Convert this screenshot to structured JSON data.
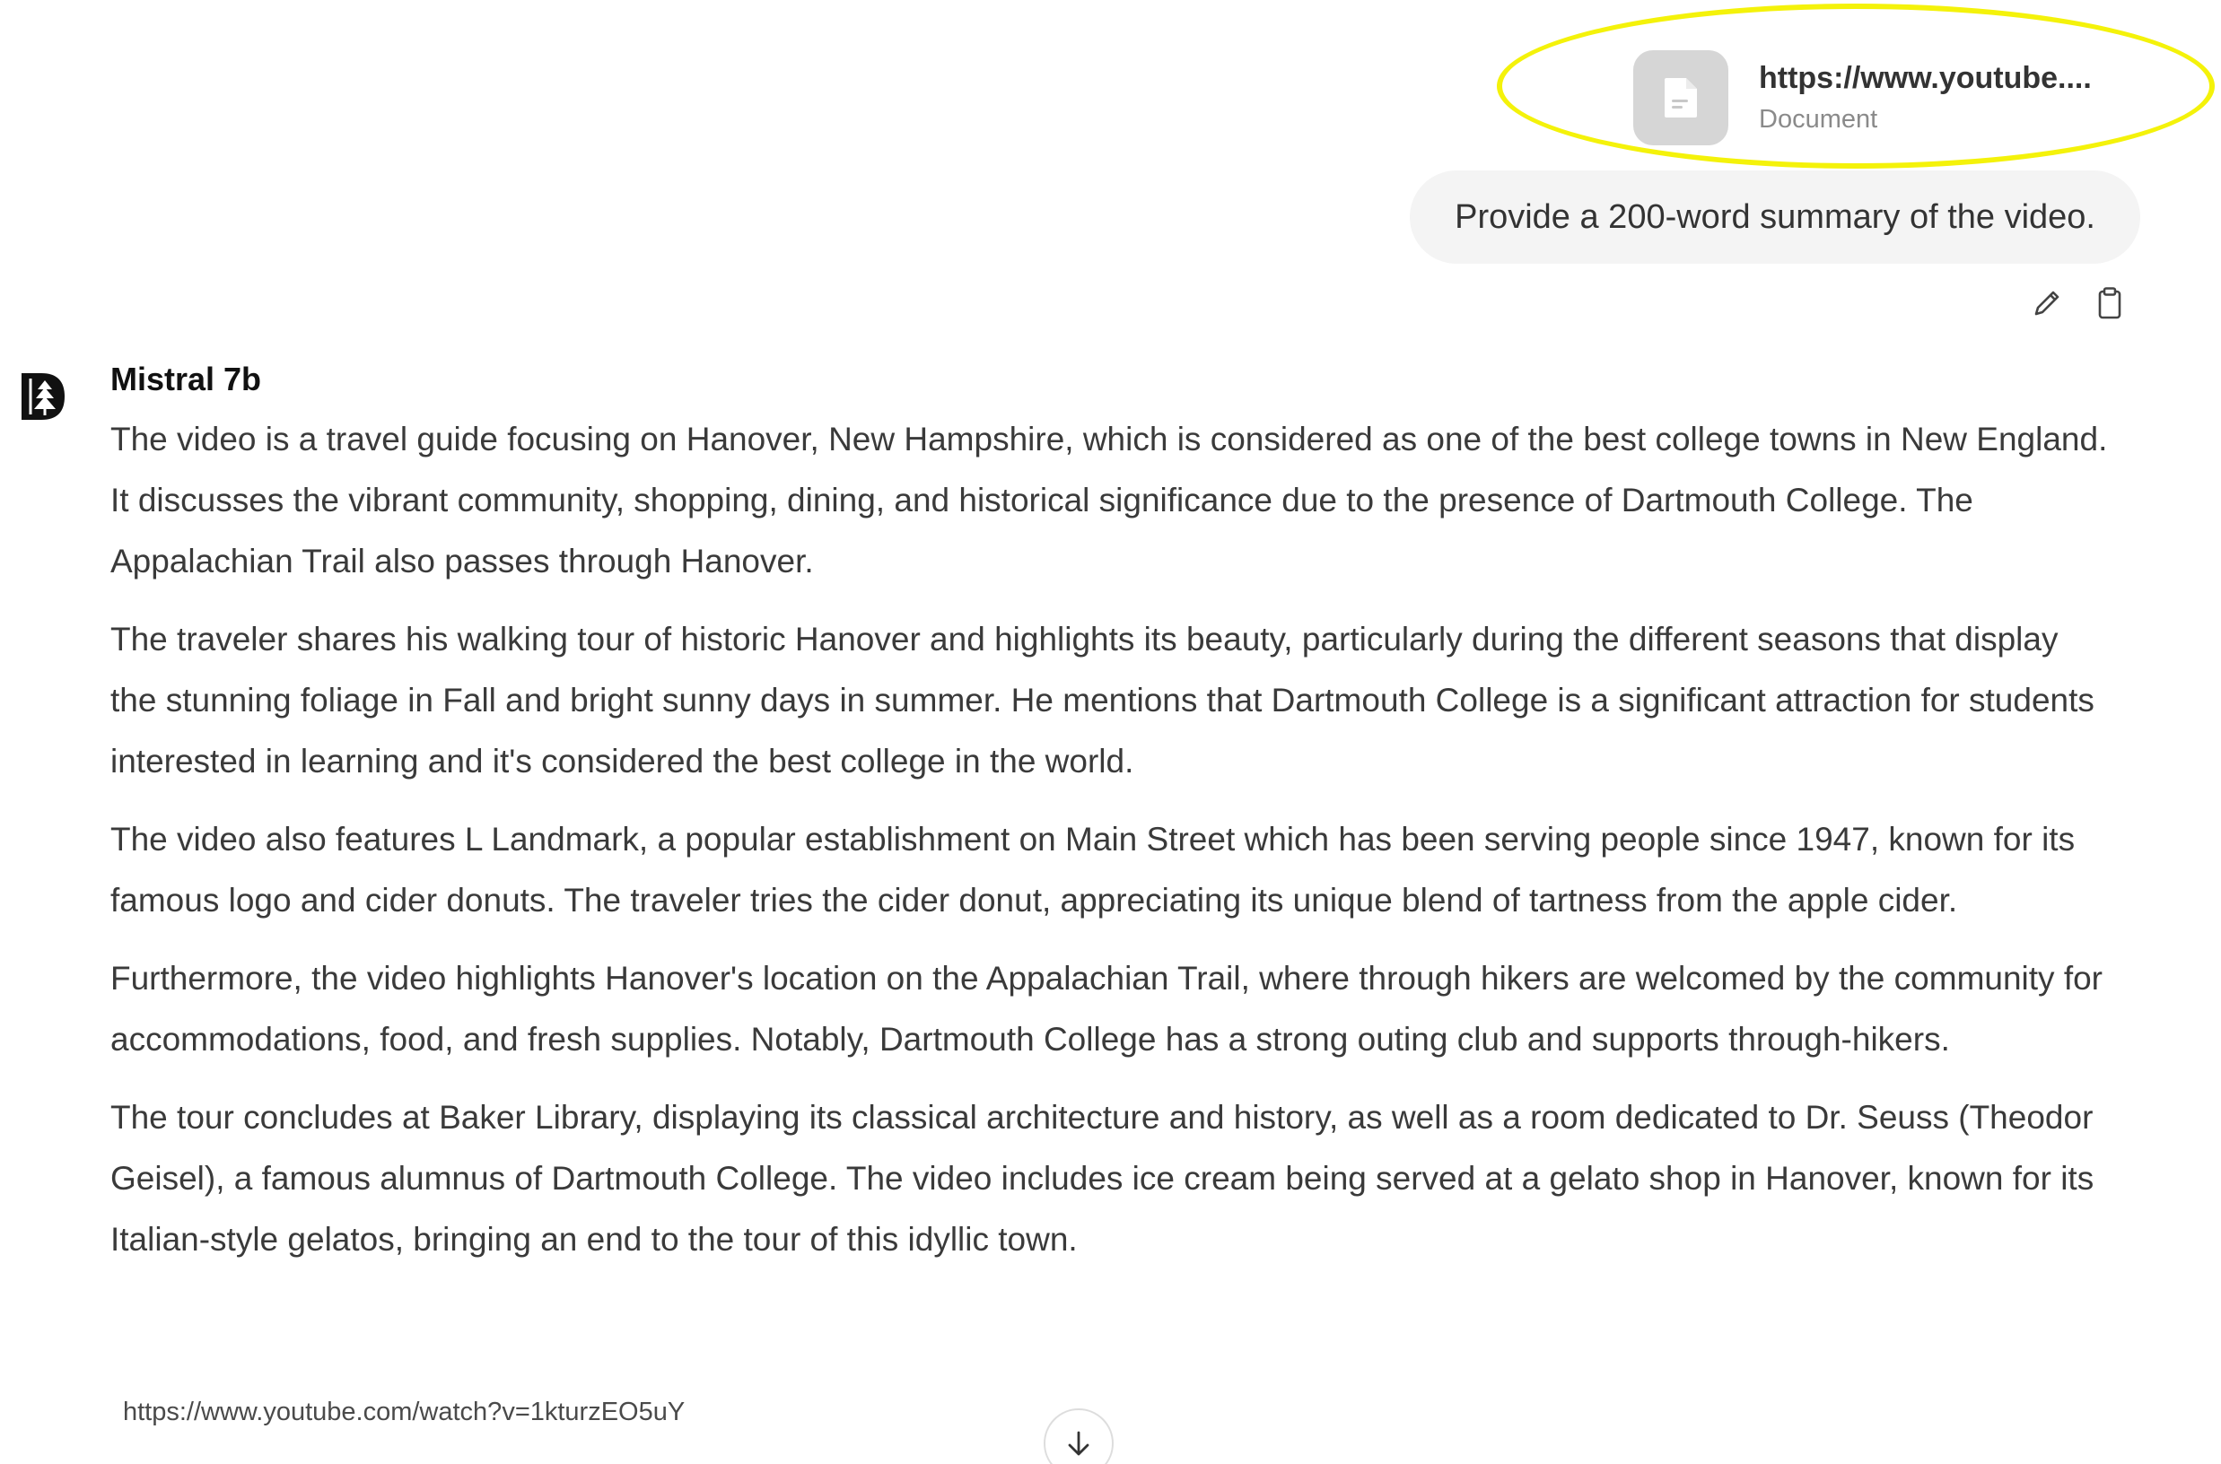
{
  "attachment": {
    "name": "https://www.youtube....",
    "type": "Document",
    "icon": "document-icon"
  },
  "user_message": {
    "text": "Provide a 200-word summary of the video.",
    "actions": [
      {
        "name": "edit-icon"
      },
      {
        "name": "clipboard-icon"
      }
    ]
  },
  "assistant": {
    "name": "Mistral 7b",
    "avatar_icon": "dartmouth-pine-logo",
    "paragraphs": [
      "The video is a travel guide focusing on Hanover, New Hampshire, which is considered as one of the best college towns in New England. It discusses the vibrant community, shopping, dining, and historical significance due to the presence of Dartmouth College. The Appalachian Trail also passes through Hanover.",
      "The traveler shares his walking tour of historic Hanover and highlights its beauty, particularly during the different seasons that display the stunning foliage in Fall and bright sunny days in summer. He mentions that Dartmouth College is a significant attraction for students interested in learning and it's considered the best college in the world.",
      "The video also features L Landmark, a popular establishment on Main Street which has been serving people since 1947, known for its famous logo and cider donuts. The traveler tries the cider donut, appreciating its unique blend of tartness from the apple cider.",
      "Furthermore, the video highlights Hanover's location on the Appalachian Trail, where through hikers are welcomed by the community for accommodations, food, and fresh supplies. Notably, Dartmouth College has a strong outing club and supports through-hikers.",
      "The tour concludes at Baker Library, displaying its classical architecture and history, as well as a room dedicated to Dr. Seuss (Theodor Geisel), a famous alumnus of Dartmouth College. The video includes ice cream being served at a gelato shop in Hanover, known for its Italian-style gelatos, bringing an end to the tour of this idyllic town."
    ],
    "source_url": "https://www.youtube.com/watch?v=1kturzEO5uY"
  },
  "scroll_button": {
    "icon": "arrow-down-icon"
  },
  "colors": {
    "highlight": "#f4f20a",
    "bubble_bg": "#f4f4f4",
    "file_tile_bg": "#d6d6d6"
  }
}
